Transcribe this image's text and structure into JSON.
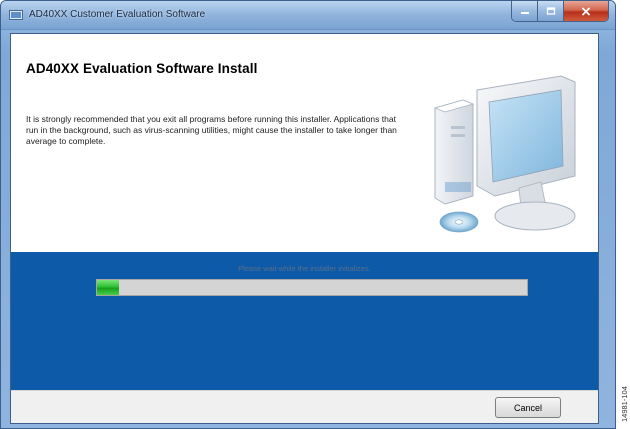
{
  "window": {
    "title": "AD40XX Customer Evaluation Software"
  },
  "window_controls": {
    "minimize_icon": "minimize-icon",
    "maximize_icon": "maximize-icon",
    "close_icon": "close-icon"
  },
  "header": {
    "title": "AD40XX Evaluation Software Install",
    "description": "It is strongly recommended that you exit all programs before running this installer. Applications that run in the background, such as virus-scanning utilities, might cause the installer to take longer than average to complete.",
    "illustration_icon": "computer-illustration"
  },
  "progress": {
    "status": "Please wait while the installer initializes.",
    "value_fraction": 0.05
  },
  "footer": {
    "cancel_label": "Cancel"
  },
  "figure_code": "14981-104",
  "colors": {
    "blue_panel": "#0d5aa8",
    "progress_green": "#2fbf34",
    "progress_track": "#d4d4d4",
    "footer_bg": "#f0f0f0"
  }
}
